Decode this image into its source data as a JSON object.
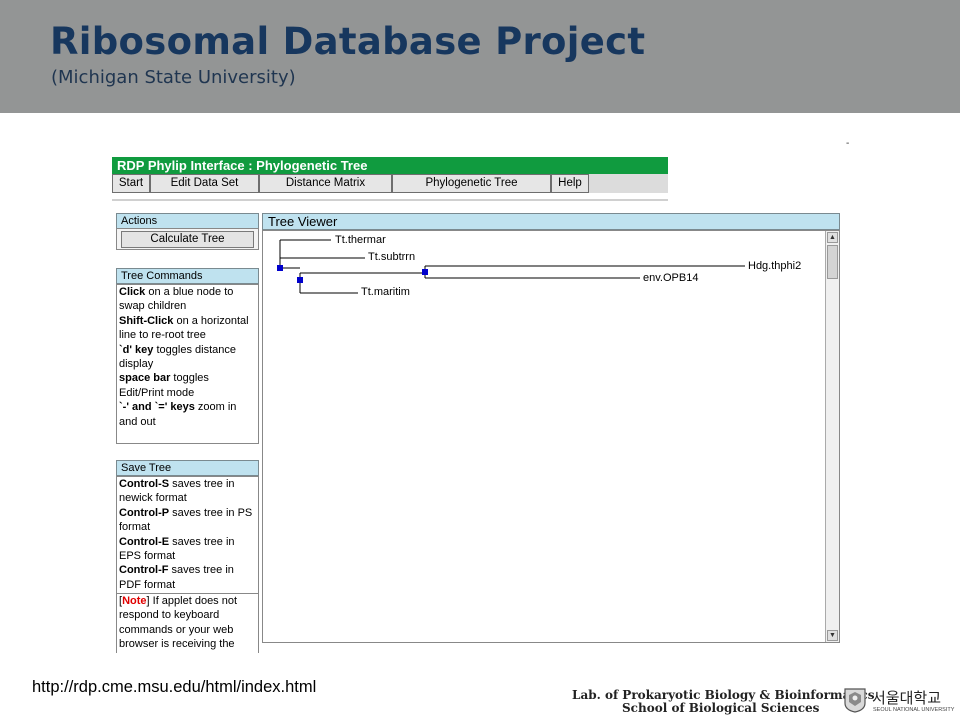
{
  "header": {
    "title": "Ribosomal Database Project",
    "subtitle": "(Michigan State University)"
  },
  "app": {
    "window_title": "RDP Phylip Interface : Phylogenetic Tree",
    "toolbar": [
      "Start",
      "Edit Data Set",
      "Distance Matrix",
      "Phylogenetic Tree",
      "Help"
    ]
  },
  "actions": {
    "heading": "Actions",
    "calculate_button": "Calculate Tree"
  },
  "tree_commands": {
    "heading": "Tree Commands",
    "lines": [
      {
        "key": "Click",
        "text": " on a blue node to swap children"
      },
      {
        "key": "Shift-Click",
        "text": " on a horizontal line to re-root tree"
      },
      {
        "key": "`d' key",
        "text": " toggles distance display"
      },
      {
        "key": "space bar",
        "text": " toggles Edit/Print mode"
      },
      {
        "key": "`-' and `=' keys",
        "text": " zoom in and out"
      }
    ]
  },
  "save_tree": {
    "heading": "Save Tree",
    "lines": [
      {
        "key": "Control-S",
        "text": " saves tree in newick format"
      },
      {
        "key": "Control-P",
        "text": " saves tree in PS format"
      },
      {
        "key": "Control-E",
        "text": " saves tree in EPS format"
      },
      {
        "key": "Control-F",
        "text": " saves tree in PDF format"
      }
    ],
    "note_open": "[",
    "note_label": "Note",
    "note_close": "]",
    "note_text": " If applet does not respond to keyboard commands or your web browser is receiving the"
  },
  "tree_viewer": {
    "heading": "Tree Viewer",
    "leaves": [
      "Tt.thermar",
      "Tt.subtrrn",
      "Hdg.thphi2",
      "env.OPB14",
      "Tt.maritim"
    ],
    "node_color": "#0000cc"
  },
  "footer": {
    "url": "http://rdp.cme.msu.edu/html/index.html",
    "lab_line1": "Lab. of Prokaryotic Biology & Bioinformatics",
    "lab_line2": "School of Biological Sciences",
    "university_korean": "서울대학교",
    "university_english": "SEOUL NATIONAL UNIVERSITY"
  },
  "dash_mark": "-"
}
